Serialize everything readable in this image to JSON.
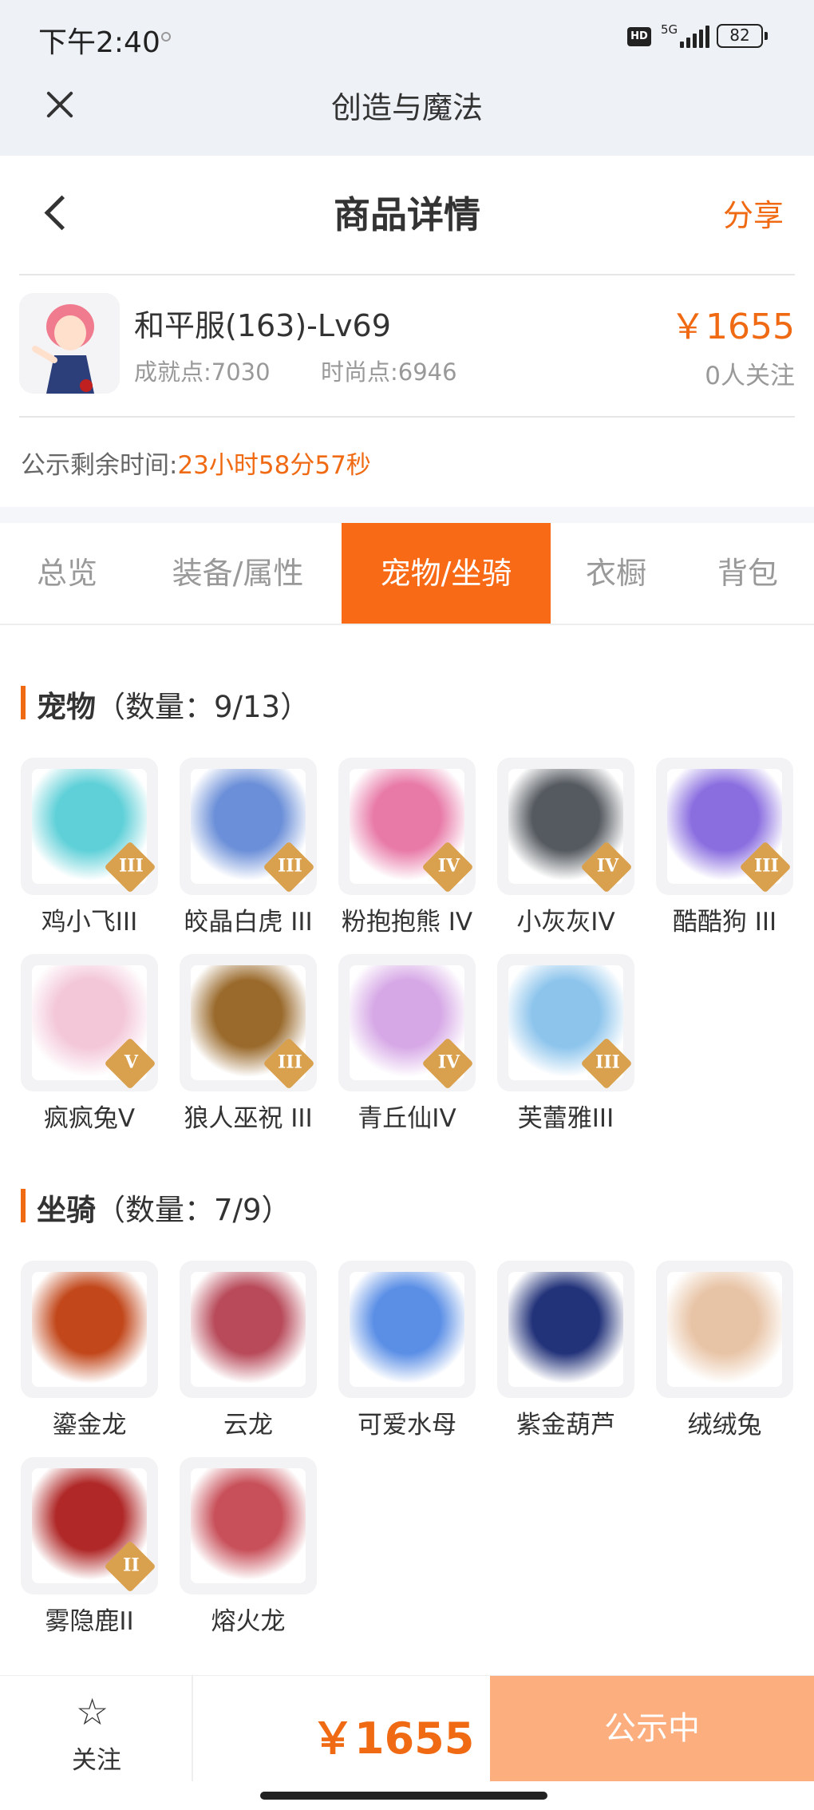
{
  "status_bar": {
    "time": "下午2:40",
    "net": "5G",
    "battery": "82"
  },
  "app": {
    "title": "创造与魔法"
  },
  "nav": {
    "title": "商品详情",
    "share": "分享"
  },
  "product": {
    "name": "和平服(163)-Lv69",
    "achievement": "成就点:7030",
    "fashion": "时尚点:6946",
    "price": "￥1655",
    "followers": "0人关注"
  },
  "publicity": {
    "label": "公示剩余时间:",
    "countdown": "23小时58分57秒"
  },
  "tabs": [
    {
      "label": "总览"
    },
    {
      "label": "装备/属性"
    },
    {
      "label": "宠物/坐骑"
    },
    {
      "label": "衣橱"
    },
    {
      "label": "背包"
    }
  ],
  "pets": {
    "title": "宠物",
    "count": "（数量：9/13）",
    "items": [
      {
        "name": "鸡小飞III",
        "rank": "III",
        "color": "#5fd0d8"
      },
      {
        "name": "皎晶白虎 III",
        "rank": "III",
        "color": "#6b8fd8"
      },
      {
        "name": "粉抱抱熊 IV",
        "rank": "IV",
        "color": "#e87aa8"
      },
      {
        "name": "小灰灰IV",
        "rank": "IV",
        "color": "#555a60"
      },
      {
        "name": "酷酷狗 III",
        "rank": "III",
        "color": "#8a6ee0"
      },
      {
        "name": "疯疯兔V",
        "rank": "V",
        "color": "#f3c6d8"
      },
      {
        "name": "狼人巫祝 III",
        "rank": "III",
        "color": "#9a6a2c"
      },
      {
        "name": "青丘仙IV",
        "rank": "IV",
        "color": "#d6a8e6"
      },
      {
        "name": "芙蕾雅III",
        "rank": "III",
        "color": "#8cc4ec"
      }
    ]
  },
  "mounts": {
    "title": "坐骑",
    "count": "（数量：7/9）",
    "items": [
      {
        "name": "鎏金龙",
        "rank": "",
        "color": "#c2481c"
      },
      {
        "name": "云龙",
        "rank": "",
        "color": "#b84a5a"
      },
      {
        "name": "可爱水母",
        "rank": "",
        "color": "#5b8fe6"
      },
      {
        "name": "紫金葫芦",
        "rank": "",
        "color": "#23337a"
      },
      {
        "name": "绒绒兔",
        "rank": "",
        "color": "#e8c4a6"
      },
      {
        "name": "雾隐鹿II",
        "rank": "II",
        "color": "#b02828"
      },
      {
        "name": "熔火龙",
        "rank": "",
        "color": "#c8505a"
      }
    ]
  },
  "bottom": {
    "follow": "关注",
    "price": "￥1655",
    "cta": "公示中"
  },
  "colors": {
    "accent": "#f06a13",
    "tab_active": "#f96a17",
    "cta": "#fcae7e"
  }
}
